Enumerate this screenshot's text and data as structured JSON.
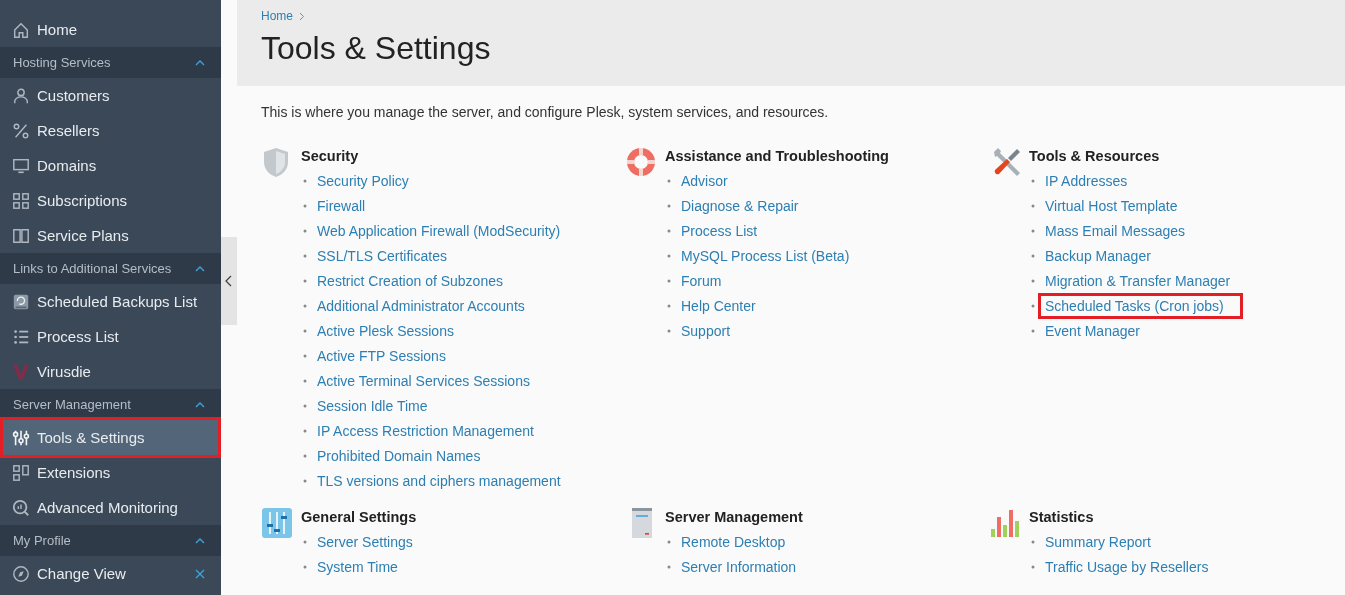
{
  "sidebar": {
    "items": [
      {
        "kind": "item",
        "label": "Home",
        "selected": false,
        "highlighted": false
      },
      {
        "kind": "group",
        "label": "Hosting Services",
        "expanded": true
      },
      {
        "kind": "item",
        "label": "Customers",
        "selected": false,
        "highlighted": false
      },
      {
        "kind": "item",
        "label": "Resellers",
        "selected": false,
        "highlighted": false
      },
      {
        "kind": "item",
        "label": "Domains",
        "selected": false,
        "highlighted": false
      },
      {
        "kind": "item",
        "label": "Subscriptions",
        "selected": false,
        "highlighted": false
      },
      {
        "kind": "item",
        "label": "Service Plans",
        "selected": false,
        "highlighted": false
      },
      {
        "kind": "group",
        "label": "Links to Additional Services",
        "expanded": true
      },
      {
        "kind": "item",
        "label": "Scheduled Backups List",
        "selected": false,
        "highlighted": false
      },
      {
        "kind": "item",
        "label": "Process List",
        "selected": false,
        "highlighted": false
      },
      {
        "kind": "item",
        "label": "Virusdie",
        "selected": false,
        "highlighted": false
      },
      {
        "kind": "group",
        "label": "Server Management",
        "expanded": true
      },
      {
        "kind": "item",
        "label": "Tools & Settings",
        "selected": true,
        "highlighted": true
      },
      {
        "kind": "item",
        "label": "Extensions",
        "selected": false,
        "highlighted": false
      },
      {
        "kind": "item",
        "label": "Advanced Monitoring",
        "selected": false,
        "highlighted": false
      },
      {
        "kind": "group",
        "label": "My Profile",
        "expanded": true
      },
      {
        "kind": "item",
        "label": "Change View",
        "selected": false,
        "highlighted": false,
        "pinned": true
      }
    ]
  },
  "breadcrumb": [
    "Home"
  ],
  "title": "Tools & Settings",
  "description": "This is where you manage the server, and configure Plesk, system services, and resources.",
  "sections": [
    {
      "title": "Security",
      "links": [
        {
          "label": "Security Policy",
          "highlighted": false
        },
        {
          "label": "Firewall",
          "highlighted": false
        },
        {
          "label": "Web Application Firewall (ModSecurity)",
          "highlighted": false
        },
        {
          "label": "SSL/TLS Certificates",
          "highlighted": false
        },
        {
          "label": "Restrict Creation of Subzones",
          "highlighted": false
        },
        {
          "label": "Additional Administrator Accounts",
          "highlighted": false
        },
        {
          "label": "Active Plesk Sessions",
          "highlighted": false
        },
        {
          "label": "Active FTP Sessions",
          "highlighted": false
        },
        {
          "label": "Active Terminal Services Sessions",
          "highlighted": false
        },
        {
          "label": "Session Idle Time",
          "highlighted": false
        },
        {
          "label": "IP Access Restriction Management",
          "highlighted": false
        },
        {
          "label": "Prohibited Domain Names",
          "highlighted": false
        },
        {
          "label": "TLS versions and ciphers management",
          "highlighted": false
        }
      ]
    },
    {
      "title": "Assistance and Troubleshooting",
      "links": [
        {
          "label": "Advisor",
          "highlighted": false
        },
        {
          "label": "Diagnose & Repair",
          "highlighted": false
        },
        {
          "label": "Process List",
          "highlighted": false
        },
        {
          "label": "MySQL Process List (Beta)",
          "highlighted": false
        },
        {
          "label": "Forum",
          "highlighted": false
        },
        {
          "label": "Help Center",
          "highlighted": false
        },
        {
          "label": "Support",
          "highlighted": false
        }
      ]
    },
    {
      "title": "Tools & Resources",
      "links": [
        {
          "label": "IP Addresses",
          "highlighted": false
        },
        {
          "label": "Virtual Host Template",
          "highlighted": false
        },
        {
          "label": "Mass Email Messages",
          "highlighted": false
        },
        {
          "label": "Backup Manager",
          "highlighted": false
        },
        {
          "label": "Migration & Transfer Manager",
          "highlighted": false
        },
        {
          "label": "Scheduled Tasks (Cron jobs)",
          "highlighted": true
        },
        {
          "label": "Event Manager",
          "highlighted": false
        }
      ]
    },
    {
      "title": "General Settings",
      "links": [
        {
          "label": "Server Settings",
          "highlighted": false
        },
        {
          "label": "System Time",
          "highlighted": false
        }
      ]
    },
    {
      "title": "Server Management",
      "links": [
        {
          "label": "Remote Desktop",
          "highlighted": false
        },
        {
          "label": "Server Information",
          "highlighted": false
        }
      ]
    },
    {
      "title": "Statistics",
      "links": [
        {
          "label": "Summary Report",
          "highlighted": false
        },
        {
          "label": "Traffic Usage by Resellers",
          "highlighted": false
        }
      ]
    }
  ]
}
